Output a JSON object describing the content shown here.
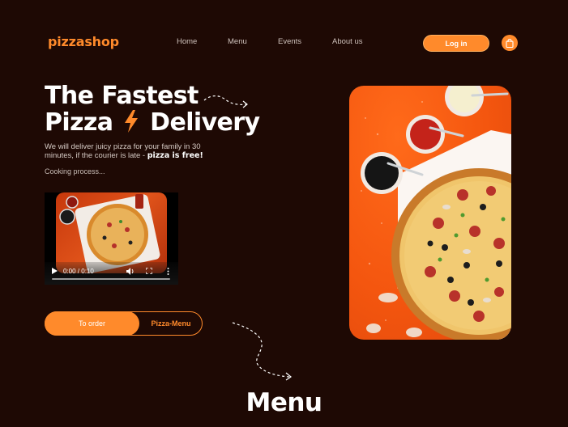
{
  "header": {
    "logo": "pizzashop",
    "nav": [
      "Home",
      "Menu",
      "Events",
      "About us"
    ],
    "login_label": "Log in",
    "cart_icon": "shopping-bag-icon"
  },
  "hero": {
    "title_line1": "The Fastest",
    "title_line2_a": "Pizza",
    "title_line2_b": "Delivery",
    "description": "We will deliver juicy pizza for your family in 30 minutes, if the courier is late - ",
    "description_bold": "pizza is free!",
    "cooking_label": "Cooking process...",
    "video_time": "0:00 / 0:10",
    "order_label": "To order",
    "menu_label": "Pizza-Menu"
  },
  "menu_section": {
    "title": "Menu"
  },
  "colors": {
    "background": "#1e0904",
    "accent": "#ff8a2b",
    "text": "#ffffff"
  }
}
